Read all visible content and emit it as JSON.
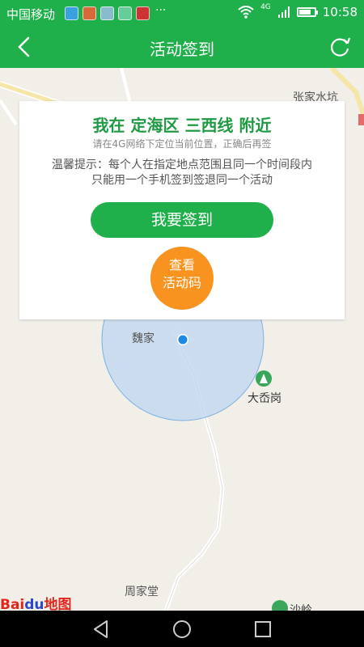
{
  "status_bar": {
    "carrier": "中国移动",
    "overflow": "···",
    "network": "4G",
    "time": "10:58",
    "battery_level": 0.8,
    "icons": [
      "wifi-icon",
      "signal-icon",
      "battery-icon"
    ]
  },
  "app_bar": {
    "title": "活动签到",
    "back_icon": "back-chevron-icon",
    "refresh_icon": "refresh-icon"
  },
  "map": {
    "labels": {
      "zhangjia": "张家水坑",
      "weijia": "魏家",
      "daxiang": "大岙岗",
      "zhoujiatang": "周家堂",
      "shaling": "沙岭"
    },
    "logo": {
      "part1": "Bai",
      "part2": "du",
      "part3": "地图"
    }
  },
  "card": {
    "location_prefix": "我在 ",
    "district": "定海区",
    "area": "三西线",
    "location_suffix": " 附近",
    "small_hint": "请在4G网络下定位当前位置，正确后再签",
    "tip_line1": "温馨提示：每个人在指定地点范围且同一个时间段内",
    "tip_line2": "只能用一个手机签到签退同一个活动",
    "checkin_button": "我要签到",
    "code_button_line1": "查看",
    "code_button_line2": "活动码"
  },
  "colors": {
    "primary_green": "#20b04b",
    "orange": "#f7931e",
    "location_blue": "#1e88e5"
  },
  "nav_bar": {
    "icons": [
      "back-triangle-icon",
      "home-circle-icon",
      "recents-square-icon"
    ]
  }
}
